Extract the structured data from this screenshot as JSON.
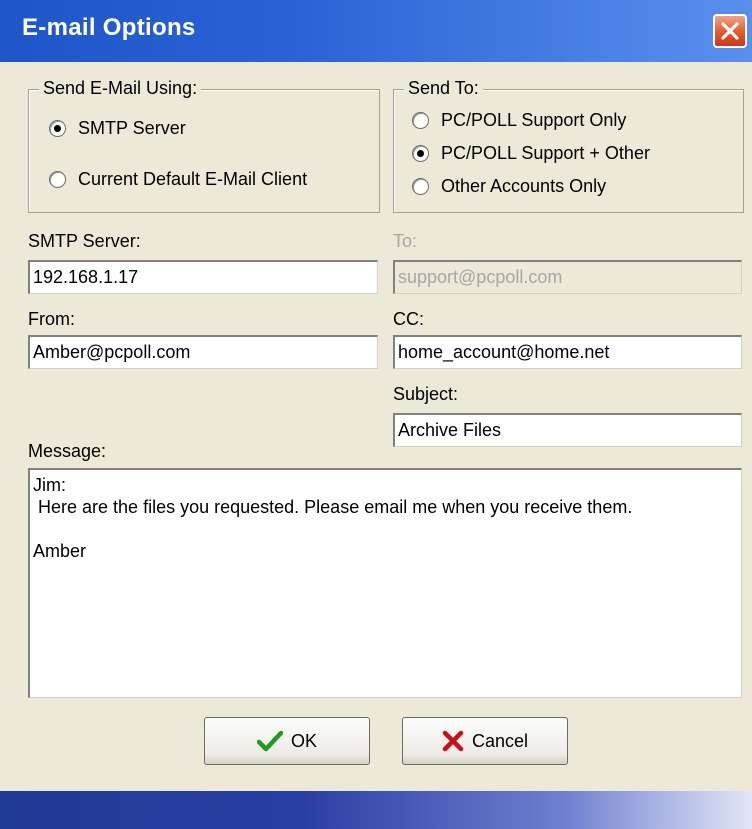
{
  "window": {
    "title": "E-mail Options"
  },
  "send_using": {
    "legend": "Send E-Mail Using:",
    "options": [
      {
        "label": "SMTP Server",
        "checked": true
      },
      {
        "label": "Current Default E-Mail Client",
        "checked": false
      }
    ]
  },
  "send_to": {
    "legend": "Send To:",
    "options": [
      {
        "label": "PC/POLL Support Only",
        "checked": false
      },
      {
        "label": "PC/POLL Support + Other",
        "checked": true
      },
      {
        "label": "Other Accounts Only",
        "checked": false
      }
    ]
  },
  "fields": {
    "smtp_server": {
      "label": "SMTP Server:",
      "value": "192.168.1.17"
    },
    "to": {
      "label": "To:",
      "value": "support@pcpoll.com",
      "disabled": true
    },
    "from": {
      "label": "From:",
      "value": "Amber@pcpoll.com"
    },
    "cc": {
      "label": "CC:",
      "value": "home_account@home.net"
    },
    "subject": {
      "label": "Subject:",
      "value": "Archive Files"
    },
    "message": {
      "label": "Message:",
      "value": "Jim:\n Here are the files you requested. Please email me when you receive them.\n\nAmber"
    }
  },
  "buttons": {
    "ok": "OK",
    "cancel": "Cancel"
  },
  "colors": {
    "titlebar": "#2b63d6",
    "close": "#e2582f",
    "ok_check": "#1f9a1f",
    "cancel_x": "#c8101a"
  }
}
